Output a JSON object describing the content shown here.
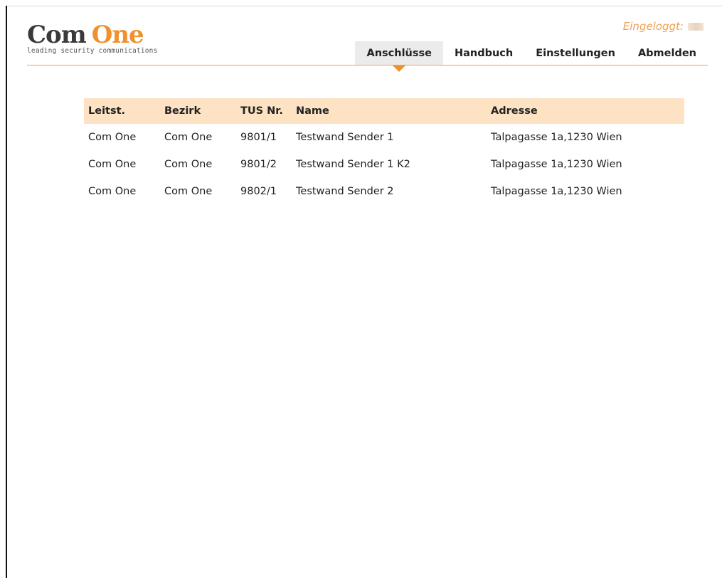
{
  "logo": {
    "word1": "Com",
    "word2": "One",
    "tagline": "leading security communications",
    "colors": {
      "dark": "#3a3a3a",
      "accent": "#f0912f"
    }
  },
  "login": {
    "label": "Eingeloggt:"
  },
  "nav": [
    {
      "label": "Anschlüsse",
      "active": true
    },
    {
      "label": "Handbuch",
      "active": false
    },
    {
      "label": "Einstellungen",
      "active": false
    },
    {
      "label": "Abmelden",
      "active": false
    }
  ],
  "table": {
    "headers": [
      "Leitst.",
      "Bezirk",
      "TUS Nr.",
      "Name",
      "Adresse"
    ],
    "rows": [
      [
        "Com One",
        "Com One",
        "9801/1",
        "Testwand Sender 1",
        "Talpagasse 1a,1230 Wien"
      ],
      [
        "Com One",
        "Com One",
        "9801/2",
        "Testwand Sender 1 K2",
        "Talpagasse 1a,1230 Wien"
      ],
      [
        "Com One",
        "Com One",
        "9802/1",
        "Testwand Sender 2",
        "Talpagasse 1a,1230 Wien"
      ]
    ]
  },
  "colors": {
    "accent": "#f0912f",
    "header_bg": "#fde3c4",
    "active_tab_bg": "#ebebeb"
  }
}
